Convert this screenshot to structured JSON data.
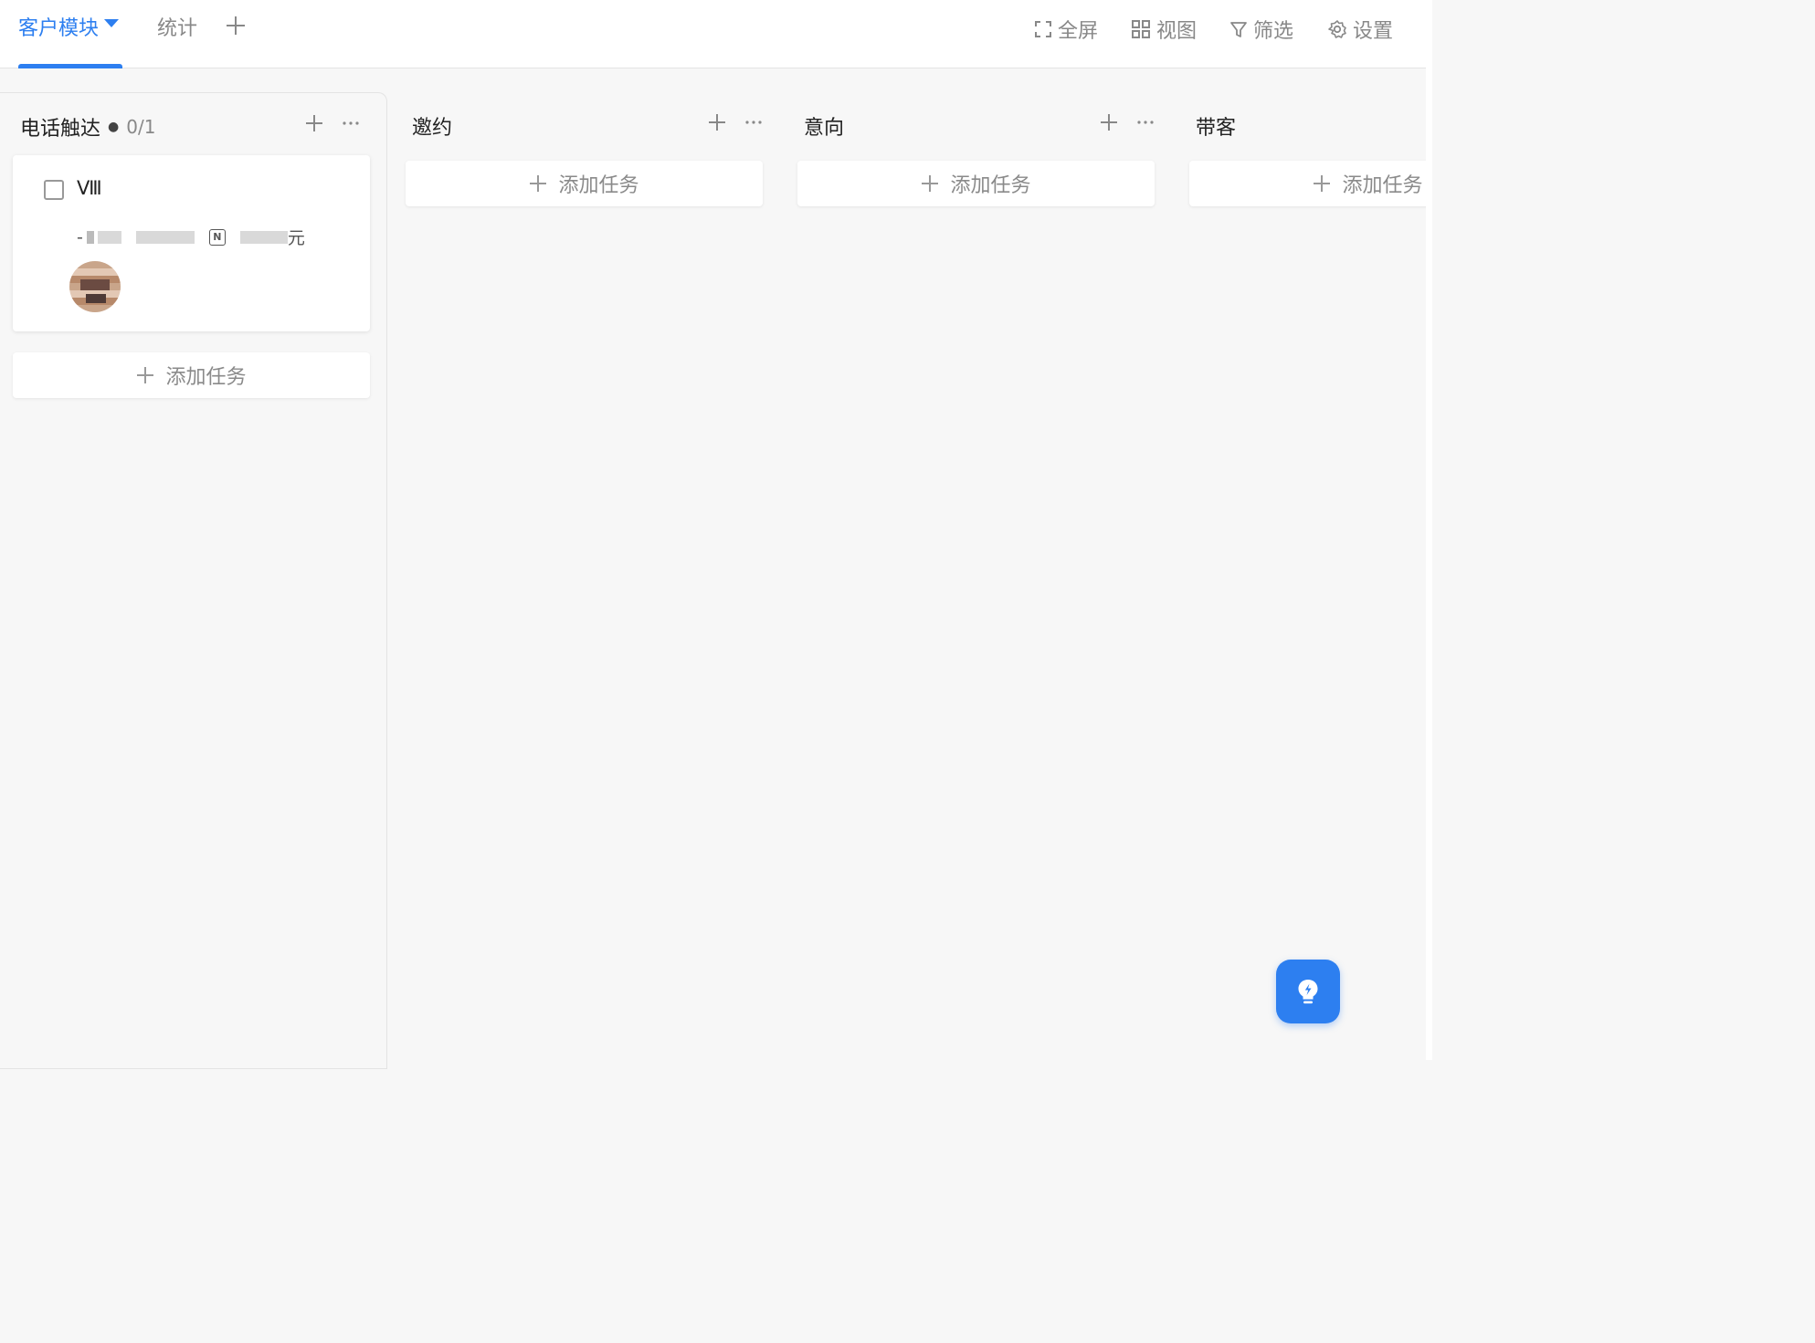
{
  "tabs": [
    {
      "label": "客户模块",
      "active": true
    },
    {
      "label": "统计",
      "active": false
    }
  ],
  "toolbar": {
    "fullscreen": "全屏",
    "view": "视图",
    "filter": "筛选",
    "settings": "设置"
  },
  "columns": [
    {
      "title": "电话触达",
      "count": "0/1",
      "add_task": "添加任务"
    },
    {
      "title": "邀约",
      "add_task": "添加任务"
    },
    {
      "title": "意向",
      "add_task": "添加任务"
    },
    {
      "title": "带客",
      "add_task": "添加任务"
    }
  ],
  "card": {
    "title": "Ⅷ",
    "amount_suffix": "元"
  },
  "colors": {
    "accent": "#2d7ff0",
    "background": "#f7f7f7"
  }
}
